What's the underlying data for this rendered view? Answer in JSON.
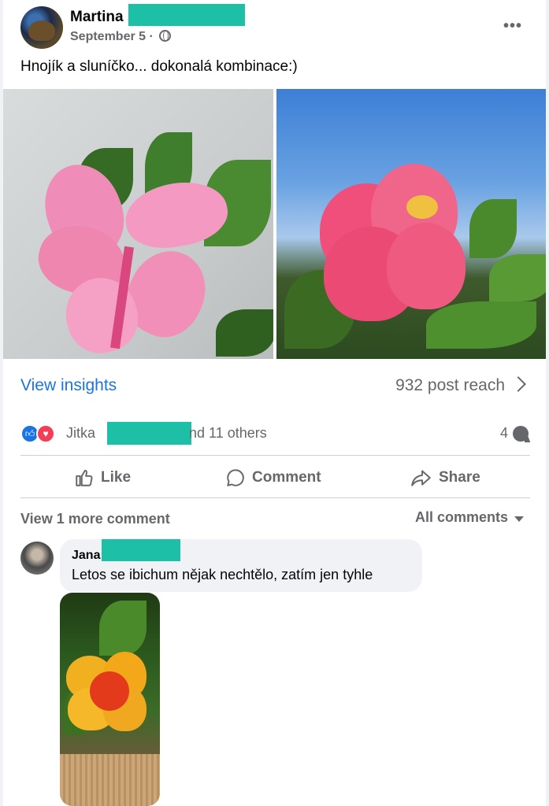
{
  "post": {
    "author": "Martina",
    "date": "September 5 ·",
    "caption": "Hnojík a sluníčko... dokonalá kombinace:)"
  },
  "insights": {
    "link_label": "View insights",
    "reach": "932 post reach"
  },
  "reactions": {
    "reactor_name": "Jitka",
    "others_suffix": "nd 11 others",
    "comment_count": "4"
  },
  "actions": {
    "like": "Like",
    "comment": "Comment",
    "share": "Share"
  },
  "comments_section": {
    "view_more": "View 1 more comment",
    "sort": "All comments",
    "comment": {
      "author": "Jana",
      "text": "Letos se ibichum nějak nechtělo, zatím jen tyhle"
    }
  },
  "colors": {
    "accent": "#1b74e4",
    "redaction": "#1dbfa6",
    "secondary_text": "#65676b"
  }
}
